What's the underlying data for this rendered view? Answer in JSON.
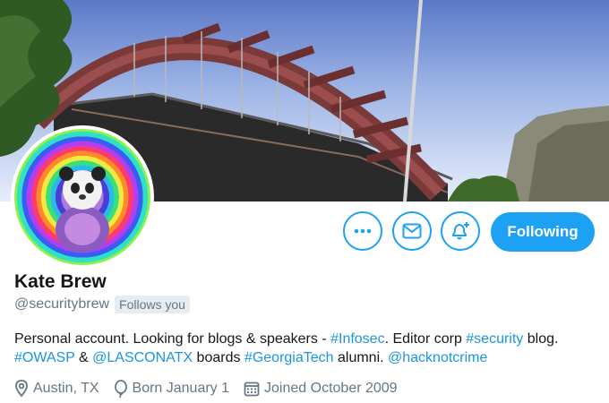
{
  "profile": {
    "name": "Kate Brew",
    "handle": "@securitybrew",
    "follows_you": "Follows you",
    "bio": {
      "p1": "Personal account. Looking for blogs & speakers - ",
      "tag_infosec": "#Infosec",
      "p2": ". Editor corp ",
      "tag_security": "#security",
      "p3": " blog. ",
      "tag_owasp": "#OWASP",
      "p4": " & ",
      "mention_lascon": "@LASCONATX",
      "p5": " boards ",
      "tag_gatech": "#GeorgiaTech",
      "p6": " alumni. ",
      "mention_hacknot": "@hacknotcrime"
    },
    "location": "Austin, TX",
    "birthday": "Born January 1",
    "joined": "Joined October 2009"
  },
  "actions": {
    "following_label": "Following",
    "more_icon": "more-icon",
    "message_icon": "envelope-icon",
    "notify_icon": "bell-plus-icon"
  },
  "icons": {
    "location": "location-pin-icon",
    "birthday": "balloon-icon",
    "joined": "calendar-icon"
  },
  "colors": {
    "accent": "#1da1f2",
    "link": "#1b95e0",
    "muted": "#657786",
    "text": "#14171a"
  }
}
